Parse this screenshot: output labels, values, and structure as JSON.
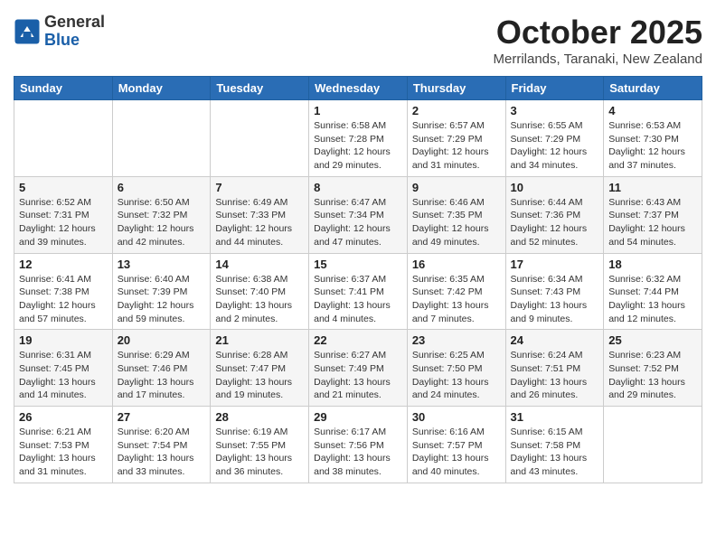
{
  "logo": {
    "general": "General",
    "blue": "Blue"
  },
  "title": "October 2025",
  "location": "Merrilands, Taranaki, New Zealand",
  "days_of_week": [
    "Sunday",
    "Monday",
    "Tuesday",
    "Wednesday",
    "Thursday",
    "Friday",
    "Saturday"
  ],
  "weeks": [
    [
      {
        "day": "",
        "sunrise": "",
        "sunset": "",
        "daylight": ""
      },
      {
        "day": "",
        "sunrise": "",
        "sunset": "",
        "daylight": ""
      },
      {
        "day": "",
        "sunrise": "",
        "sunset": "",
        "daylight": ""
      },
      {
        "day": "1",
        "sunrise": "Sunrise: 6:58 AM",
        "sunset": "Sunset: 7:28 PM",
        "daylight": "Daylight: 12 hours and 29 minutes."
      },
      {
        "day": "2",
        "sunrise": "Sunrise: 6:57 AM",
        "sunset": "Sunset: 7:29 PM",
        "daylight": "Daylight: 12 hours and 31 minutes."
      },
      {
        "day": "3",
        "sunrise": "Sunrise: 6:55 AM",
        "sunset": "Sunset: 7:29 PM",
        "daylight": "Daylight: 12 hours and 34 minutes."
      },
      {
        "day": "4",
        "sunrise": "Sunrise: 6:53 AM",
        "sunset": "Sunset: 7:30 PM",
        "daylight": "Daylight: 12 hours and 37 minutes."
      }
    ],
    [
      {
        "day": "5",
        "sunrise": "Sunrise: 6:52 AM",
        "sunset": "Sunset: 7:31 PM",
        "daylight": "Daylight: 12 hours and 39 minutes."
      },
      {
        "day": "6",
        "sunrise": "Sunrise: 6:50 AM",
        "sunset": "Sunset: 7:32 PM",
        "daylight": "Daylight: 12 hours and 42 minutes."
      },
      {
        "day": "7",
        "sunrise": "Sunrise: 6:49 AM",
        "sunset": "Sunset: 7:33 PM",
        "daylight": "Daylight: 12 hours and 44 minutes."
      },
      {
        "day": "8",
        "sunrise": "Sunrise: 6:47 AM",
        "sunset": "Sunset: 7:34 PM",
        "daylight": "Daylight: 12 hours and 47 minutes."
      },
      {
        "day": "9",
        "sunrise": "Sunrise: 6:46 AM",
        "sunset": "Sunset: 7:35 PM",
        "daylight": "Daylight: 12 hours and 49 minutes."
      },
      {
        "day": "10",
        "sunrise": "Sunrise: 6:44 AM",
        "sunset": "Sunset: 7:36 PM",
        "daylight": "Daylight: 12 hours and 52 minutes."
      },
      {
        "day": "11",
        "sunrise": "Sunrise: 6:43 AM",
        "sunset": "Sunset: 7:37 PM",
        "daylight": "Daylight: 12 hours and 54 minutes."
      }
    ],
    [
      {
        "day": "12",
        "sunrise": "Sunrise: 6:41 AM",
        "sunset": "Sunset: 7:38 PM",
        "daylight": "Daylight: 12 hours and 57 minutes."
      },
      {
        "day": "13",
        "sunrise": "Sunrise: 6:40 AM",
        "sunset": "Sunset: 7:39 PM",
        "daylight": "Daylight: 12 hours and 59 minutes."
      },
      {
        "day": "14",
        "sunrise": "Sunrise: 6:38 AM",
        "sunset": "Sunset: 7:40 PM",
        "daylight": "Daylight: 13 hours and 2 minutes."
      },
      {
        "day": "15",
        "sunrise": "Sunrise: 6:37 AM",
        "sunset": "Sunset: 7:41 PM",
        "daylight": "Daylight: 13 hours and 4 minutes."
      },
      {
        "day": "16",
        "sunrise": "Sunrise: 6:35 AM",
        "sunset": "Sunset: 7:42 PM",
        "daylight": "Daylight: 13 hours and 7 minutes."
      },
      {
        "day": "17",
        "sunrise": "Sunrise: 6:34 AM",
        "sunset": "Sunset: 7:43 PM",
        "daylight": "Daylight: 13 hours and 9 minutes."
      },
      {
        "day": "18",
        "sunrise": "Sunrise: 6:32 AM",
        "sunset": "Sunset: 7:44 PM",
        "daylight": "Daylight: 13 hours and 12 minutes."
      }
    ],
    [
      {
        "day": "19",
        "sunrise": "Sunrise: 6:31 AM",
        "sunset": "Sunset: 7:45 PM",
        "daylight": "Daylight: 13 hours and 14 minutes."
      },
      {
        "day": "20",
        "sunrise": "Sunrise: 6:29 AM",
        "sunset": "Sunset: 7:46 PM",
        "daylight": "Daylight: 13 hours and 17 minutes."
      },
      {
        "day": "21",
        "sunrise": "Sunrise: 6:28 AM",
        "sunset": "Sunset: 7:47 PM",
        "daylight": "Daylight: 13 hours and 19 minutes."
      },
      {
        "day": "22",
        "sunrise": "Sunrise: 6:27 AM",
        "sunset": "Sunset: 7:49 PM",
        "daylight": "Daylight: 13 hours and 21 minutes."
      },
      {
        "day": "23",
        "sunrise": "Sunrise: 6:25 AM",
        "sunset": "Sunset: 7:50 PM",
        "daylight": "Daylight: 13 hours and 24 minutes."
      },
      {
        "day": "24",
        "sunrise": "Sunrise: 6:24 AM",
        "sunset": "Sunset: 7:51 PM",
        "daylight": "Daylight: 13 hours and 26 minutes."
      },
      {
        "day": "25",
        "sunrise": "Sunrise: 6:23 AM",
        "sunset": "Sunset: 7:52 PM",
        "daylight": "Daylight: 13 hours and 29 minutes."
      }
    ],
    [
      {
        "day": "26",
        "sunrise": "Sunrise: 6:21 AM",
        "sunset": "Sunset: 7:53 PM",
        "daylight": "Daylight: 13 hours and 31 minutes."
      },
      {
        "day": "27",
        "sunrise": "Sunrise: 6:20 AM",
        "sunset": "Sunset: 7:54 PM",
        "daylight": "Daylight: 13 hours and 33 minutes."
      },
      {
        "day": "28",
        "sunrise": "Sunrise: 6:19 AM",
        "sunset": "Sunset: 7:55 PM",
        "daylight": "Daylight: 13 hours and 36 minutes."
      },
      {
        "day": "29",
        "sunrise": "Sunrise: 6:17 AM",
        "sunset": "Sunset: 7:56 PM",
        "daylight": "Daylight: 13 hours and 38 minutes."
      },
      {
        "day": "30",
        "sunrise": "Sunrise: 6:16 AM",
        "sunset": "Sunset: 7:57 PM",
        "daylight": "Daylight: 13 hours and 40 minutes."
      },
      {
        "day": "31",
        "sunrise": "Sunrise: 6:15 AM",
        "sunset": "Sunset: 7:58 PM",
        "daylight": "Daylight: 13 hours and 43 minutes."
      },
      {
        "day": "",
        "sunrise": "",
        "sunset": "",
        "daylight": ""
      }
    ]
  ]
}
